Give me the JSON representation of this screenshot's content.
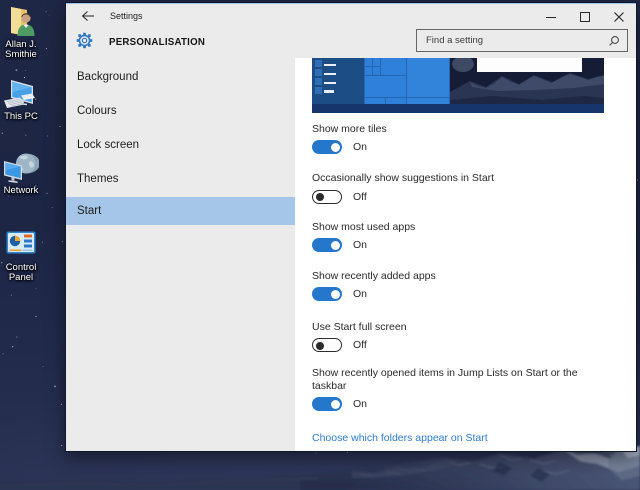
{
  "desktop": {
    "icons": [
      {
        "name": "user-folder",
        "lines": [
          "Allan J.",
          "Smithie"
        ]
      },
      {
        "name": "this-pc",
        "lines": [
          "This PC"
        ]
      },
      {
        "name": "network",
        "lines": [
          "Network"
        ]
      },
      {
        "name": "control-panel",
        "lines": [
          "Control",
          "Panel"
        ]
      }
    ]
  },
  "window": {
    "title": "Settings",
    "titlebar_icons": [
      "back-arrow-icon",
      "minimize-icon",
      "maximize-icon",
      "close-icon"
    ],
    "header": {
      "title": "PERSONALISATION",
      "icon": "gear-icon",
      "search": {
        "placeholder": "Find a setting",
        "icon": "search-icon"
      }
    },
    "sidebar": {
      "items": [
        {
          "label": "Background",
          "selected": false
        },
        {
          "label": "Colours",
          "selected": false
        },
        {
          "label": "Lock screen",
          "selected": false
        },
        {
          "label": "Themes",
          "selected": false
        },
        {
          "label": "Start",
          "selected": true
        }
      ]
    },
    "content": {
      "preview_image": "start-menu-screenshot",
      "settings": [
        {
          "label": "Show more tiles",
          "state": "On",
          "on": true
        },
        {
          "label": "Occasionally show suggestions in Start",
          "state": "Off",
          "on": false
        },
        {
          "label": "Show most used apps",
          "state": "On",
          "on": true
        },
        {
          "label": "Show recently added apps",
          "state": "On",
          "on": true
        },
        {
          "label": "Use Start full screen",
          "state": "Off",
          "on": false
        },
        {
          "label": "Show recently opened items in Jump Lists on Start or the taskbar",
          "state": "On",
          "on": true
        }
      ],
      "link": "Choose which folders appear on Start"
    }
  },
  "colors": {
    "accent": "#2577cc",
    "selected_nav": "#a5c6e8",
    "link": "#2e7cd0",
    "window_chrome": "#e7e7e7"
  }
}
